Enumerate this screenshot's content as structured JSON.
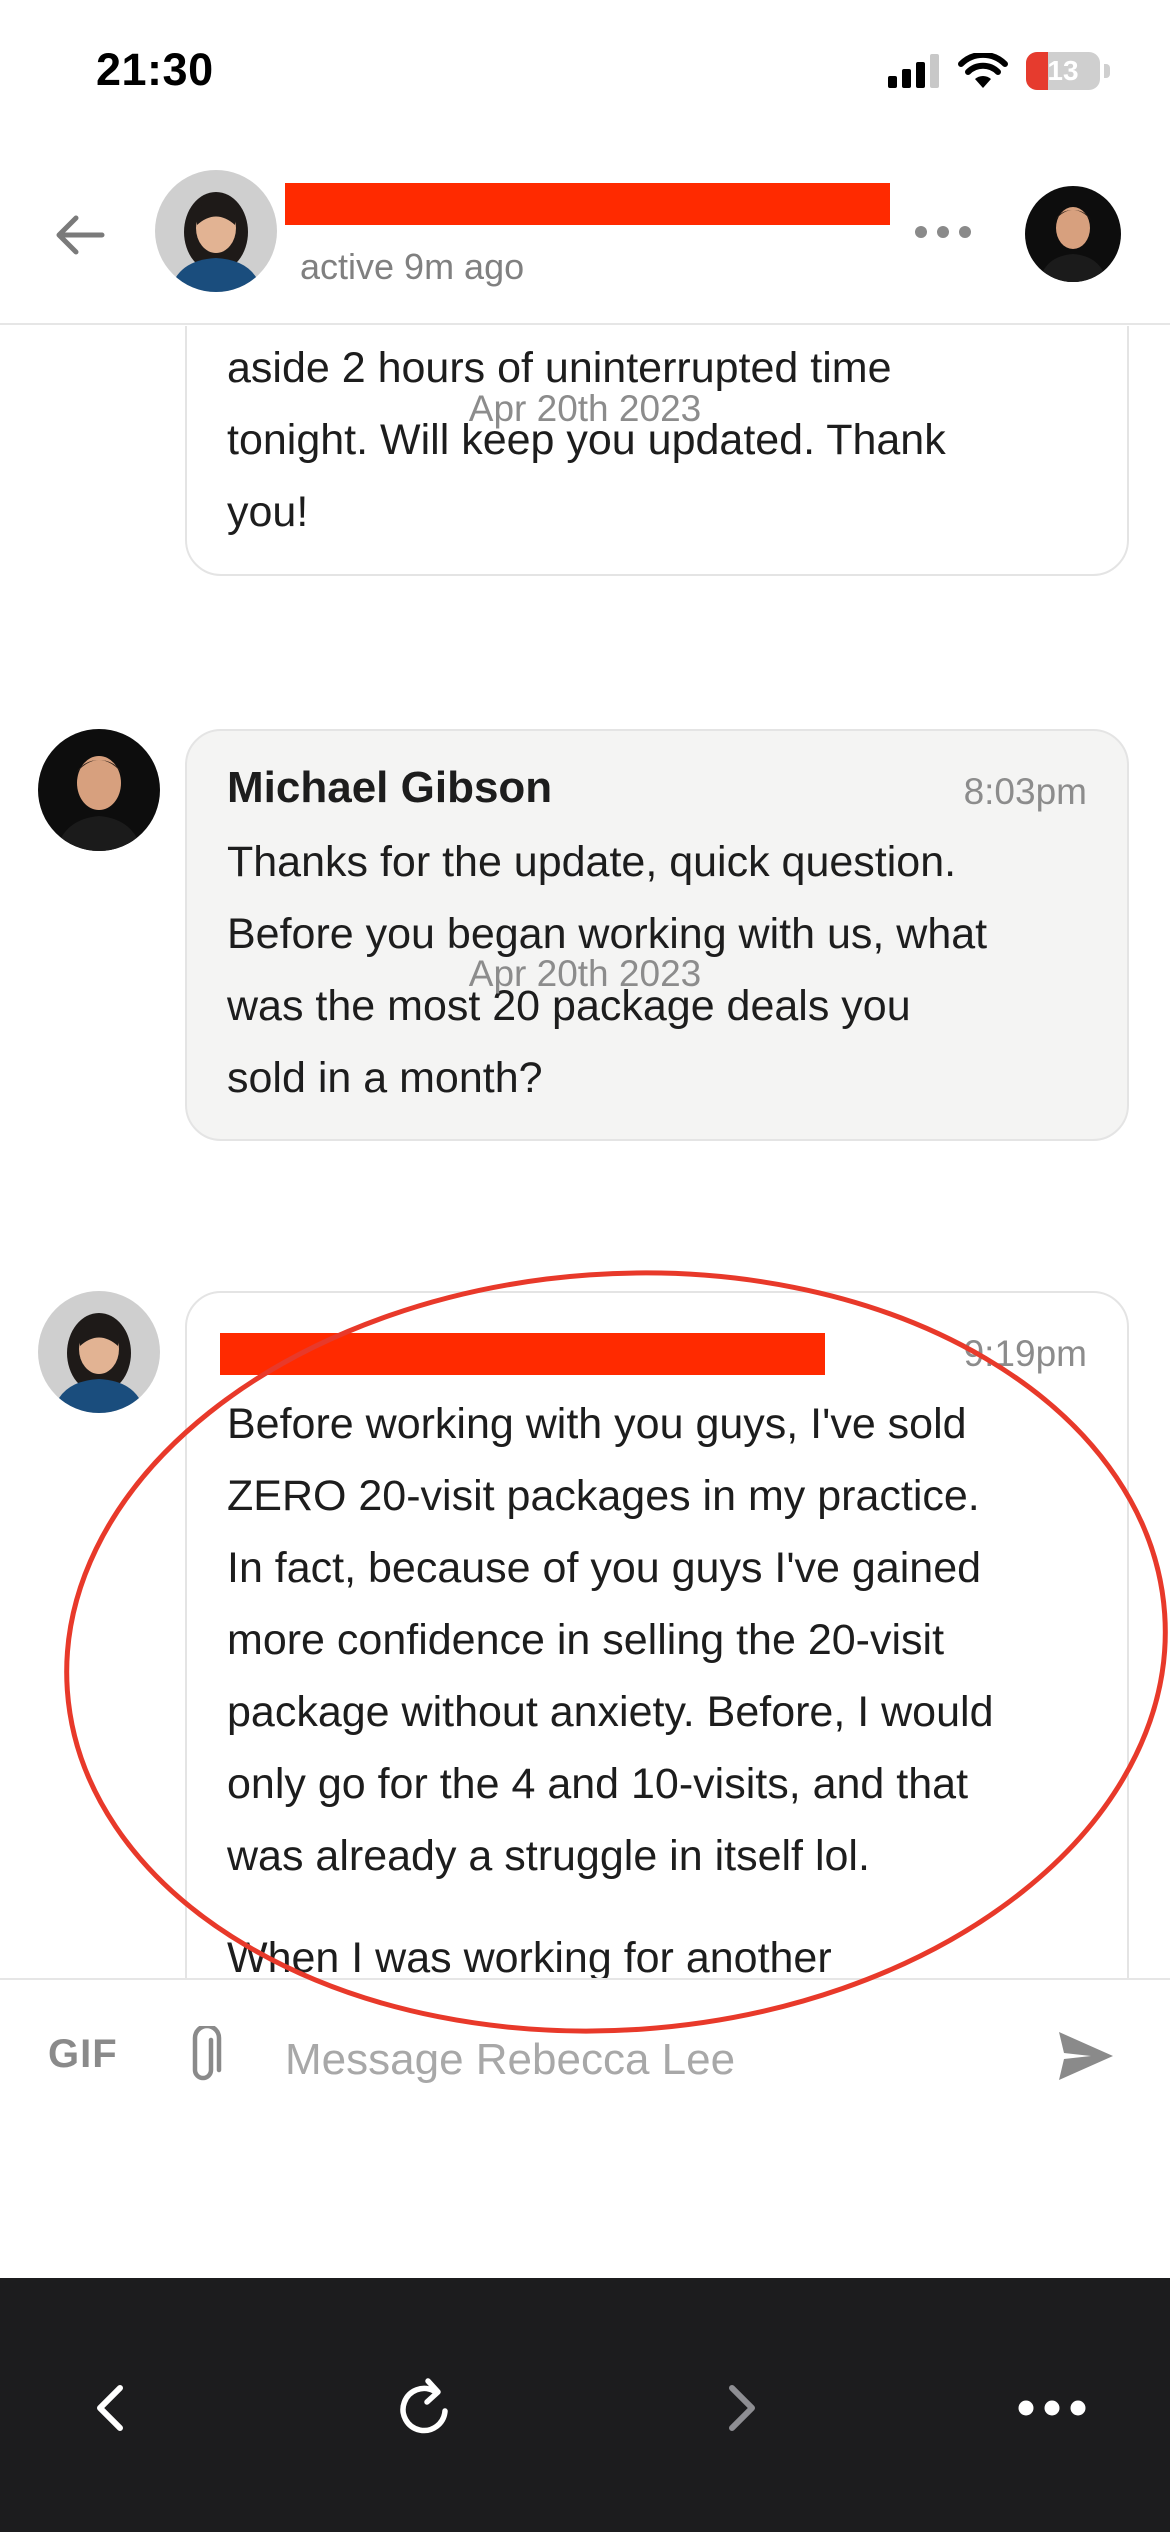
{
  "status_bar": {
    "time": "21:30",
    "battery_level": "13",
    "icons": [
      "cellular-signal-icon",
      "wifi-icon",
      "battery-icon"
    ]
  },
  "header": {
    "back_icon": "arrow-left-icon",
    "active_status": "active 9m ago",
    "more_icon": "more-horizontal-icon"
  },
  "messages": {
    "previous_message_text": "aside 2 hours of uninterrupted time tonight. Will keep you updated. Thank you!",
    "previous_message_lines": [
      "aside 2 hours of uninterrupted time",
      "tonight. Will keep you updated. Thank",
      "you!"
    ],
    "items": [
      {
        "date": "Apr 20th 2023",
        "sender": "Michael Gibson",
        "time": "8:03pm",
        "lines": [
          "Thanks for the update, quick question.",
          "Before you began working with us, what",
          "was the most 20 package deals you",
          "sold in a month?"
        ]
      },
      {
        "date": "Apr 20th 2023",
        "sender": "",
        "time": "9:19pm",
        "lines": [
          "Before working with you guys, I've sold",
          "ZERO 20-visit packages in my practice.",
          "In fact, because of you guys I've gained",
          "more confidence in selling the 20-visit",
          "package without anxiety. Before, I would",
          "only go for the 4 and 10-visits, and that",
          "was already a struggle in itself lol."
        ],
        "cut_line": "When I was working for another"
      }
    ]
  },
  "annotation": {
    "color": "#e8392a"
  },
  "composer": {
    "gif_label": "GIF",
    "placeholder": "Message Rebecca Lee",
    "value": "",
    "attach_icon": "paperclip-icon",
    "send_icon": "send-icon"
  },
  "browser_bar": {
    "icons": [
      "chevron-left-icon",
      "reload-icon",
      "chevron-right-icon",
      "more-horizontal-icon"
    ]
  },
  "colors": {
    "redaction": "#ff2a00",
    "muted_text": "#8c8c8c",
    "bubble_grey": "#f4f4f3",
    "browser_bar": "#1c1c1e"
  }
}
